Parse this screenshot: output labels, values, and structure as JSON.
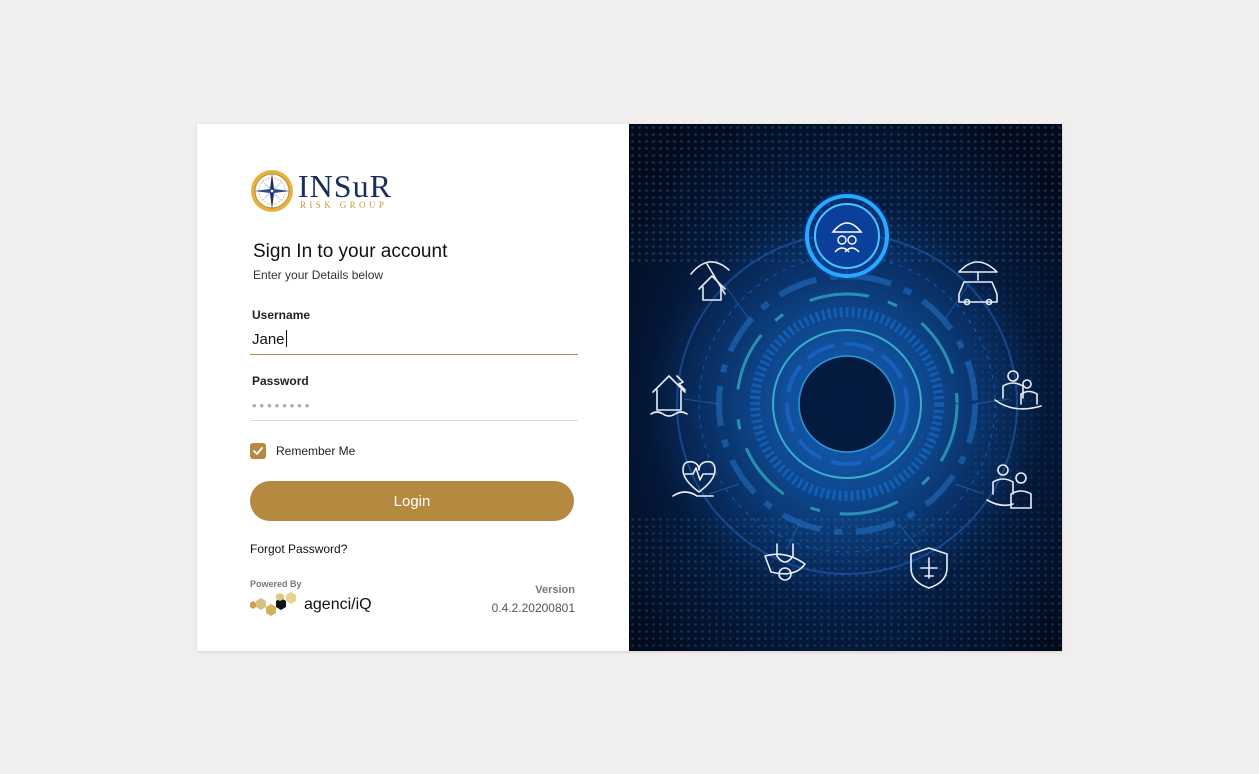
{
  "logo": {
    "name": "INSuR",
    "tagline": "RISK GROUP"
  },
  "signin": {
    "title": "Sign In to your account",
    "subtitle": "Enter your Details below"
  },
  "form": {
    "username_label": "Username",
    "username_value": "Jane",
    "password_label": "Password",
    "password_masked": "••••••••",
    "remember_label": "Remember Me",
    "remember_checked": true,
    "login_label": "Login",
    "forgot_label": "Forgot Password?"
  },
  "footer": {
    "powered_by": "Powered By",
    "brand": "agenci/iQ",
    "version_label": "Version",
    "version_value": "0.4.2.20200801"
  },
  "colors": {
    "accent": "#b5893f",
    "navy": "#1b2d5e",
    "background": "#f1eeee",
    "panel_bg": "#03122b",
    "glow": "#1e8cff"
  },
  "illustration_icons": [
    "umbrella-family-icon",
    "umbrella-home-icon",
    "umbrella-car-icon",
    "flood-house-icon",
    "family-icon",
    "health-hand-icon",
    "caregiver-icon",
    "stethoscope-icon",
    "travel-shield-icon"
  ]
}
